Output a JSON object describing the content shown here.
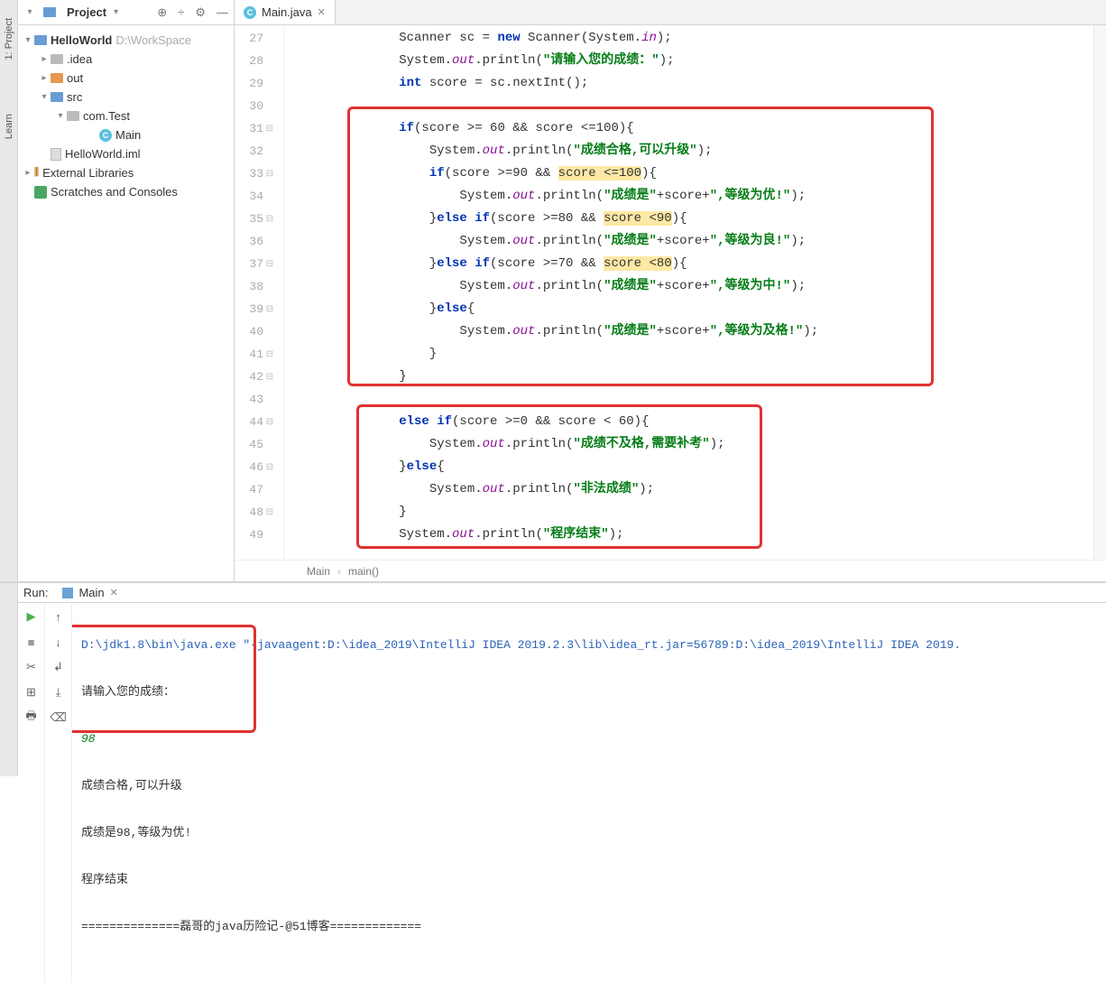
{
  "sidebar": {
    "tabs": [
      "1: Project",
      "Learn"
    ]
  },
  "projectPanel": {
    "title": "Project",
    "tree": {
      "root": {
        "label": "HelloWorld",
        "path": "D:\\WorkSpace"
      },
      "idea": ".idea",
      "out": "out",
      "src": "src",
      "pkg": "com.Test",
      "main": "Main",
      "iml": "HelloWorld.iml",
      "extLib": "External Libraries",
      "scratch": "Scratches and Consoles"
    }
  },
  "editor": {
    "tab": "Main.java",
    "lines": [
      27,
      28,
      29,
      30,
      31,
      32,
      33,
      34,
      35,
      36,
      37,
      38,
      39,
      40,
      41,
      42,
      43,
      44,
      45,
      46,
      47,
      48,
      49
    ],
    "code": {
      "l27": {
        "pre": "        Scanner sc = ",
        "kw": "new",
        "post1": " Scanner(System.",
        "field": "in",
        "post2": ");"
      },
      "l28": {
        "pre": "        System.",
        "field": "out",
        "m": ".println(",
        "str": "\"请输入您的成绩：\"",
        "post": ");"
      },
      "l29": {
        "kw": "int",
        "post": " score = sc.nextInt();"
      },
      "l31": {
        "kw": "if",
        "post": "(score >= 60 && score <=100){"
      },
      "l32": {
        "pre": "            System.",
        "field": "out",
        "m": ".println(",
        "str": "\"成绩合格,可以升级\"",
        "post": ");"
      },
      "l33": {
        "kw": "if",
        "mid": "(score >=90 && ",
        "hl": "score <=100",
        "post": "){"
      },
      "l34": {
        "pre": "                System.",
        "field": "out",
        "m": ".println(",
        "str1": "\"成绩是\"",
        "mid": "+score+",
        "str2": "\",等级为优!\"",
        "post": ");"
      },
      "l35": {
        "pre": "            }",
        "kw": "else if",
        "mid": "(score >=80 && ",
        "hl": "score <90",
        "post": "){"
      },
      "l36": {
        "pre": "                System.",
        "field": "out",
        "m": ".println(",
        "str1": "\"成绩是\"",
        "mid": "+score+",
        "str2": "\",等级为良!\"",
        "post": ");"
      },
      "l37": {
        "pre": "            }",
        "kw": "else if",
        "mid": "(score >=70 && ",
        "hl": "score <80",
        "post": "){"
      },
      "l38": {
        "pre": "                System.",
        "field": "out",
        "m": ".println(",
        "str1": "\"成绩是\"",
        "mid": "+score+",
        "str2": "\",等级为中!\"",
        "post": ");"
      },
      "l39": {
        "pre": "            }",
        "kw": "else",
        "post": "{"
      },
      "l40": {
        "pre": "                System.",
        "field": "out",
        "m": ".println(",
        "str1": "\"成绩是\"",
        "mid": "+score+",
        "str2": "\",等级为及格!\"",
        "post": ");"
      },
      "l41": "            }",
      "l42": "        }",
      "l44": {
        "kw": "else if",
        "post": "(score >=0 && score < 60){"
      },
      "l45": {
        "pre": "            System.",
        "field": "out",
        "m": ".println(",
        "str": "\"成绩不及格,需要补考\"",
        "post": ");"
      },
      "l46": {
        "pre": "        }",
        "kw": "else",
        "post": "{"
      },
      "l47": {
        "pre": "            System.",
        "field": "out",
        "m": ".println(",
        "str": "\"非法成绩\"",
        "post": ");"
      },
      "l48": "        }",
      "l49": {
        "pre": "        System.",
        "field": "out",
        "m": ".println(",
        "str": "\"程序结束\"",
        "post": ");"
      }
    },
    "breadcrumb": [
      "Main",
      "main()"
    ]
  },
  "run": {
    "label": "Run:",
    "tab": "Main",
    "console": {
      "cmd": "D:\\jdk1.8\\bin\\java.exe \"-javaagent:D:\\idea_2019\\IntelliJ IDEA 2019.2.3\\lib\\idea_rt.jar=56789:D:\\idea_2019\\IntelliJ IDEA 2019.",
      "l1": "请输入您的成绩：",
      "input": "98",
      "l3": "成绩合格,可以升级",
      "l4": "成绩是98,等级为优!",
      "l5": "程序结束",
      "l6": "==============磊哥的java历险记-@51博客============="
    }
  }
}
